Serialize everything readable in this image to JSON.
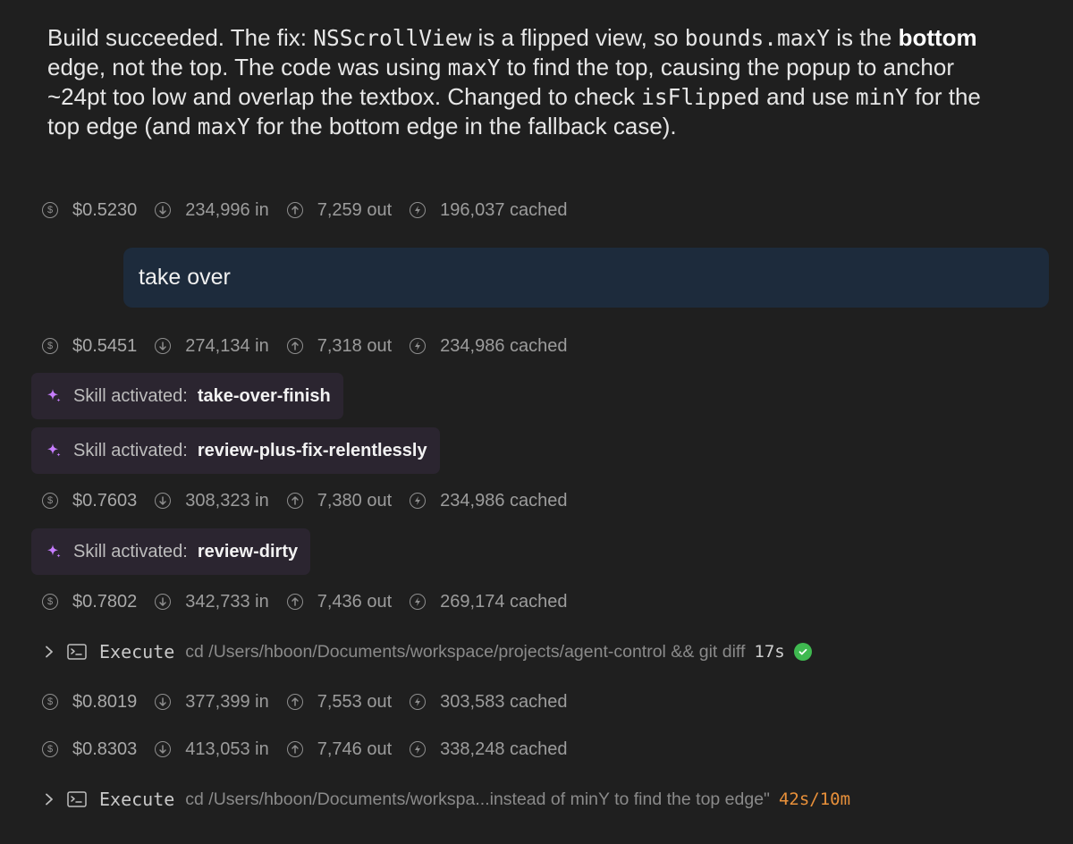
{
  "message": {
    "p1": "Build succeeded. The fix: ",
    "c1": "NSScrollView",
    "p2": " is a flipped view, so ",
    "c2": "bounds.maxY",
    "p3": " is the ",
    "b1": "bottom",
    "p4": " edge, not the top. The code was using ",
    "c3": "maxY",
    "p5": " to find the top, causing the popup to anchor ~24pt too low and overlap the textbox. Changed to check ",
    "c4": "isFlipped",
    "p6": " and use ",
    "c5": "minY",
    "p7": " for the top edge (and ",
    "c6": "maxY",
    "p8": " for the bottom edge in the fallback case)."
  },
  "stats": [
    {
      "cost": "$0.5230",
      "in": "234,996 in",
      "out": "7,259 out",
      "cached": "196,037 cached"
    },
    {
      "cost": "$0.5451",
      "in": "274,134 in",
      "out": "7,318 out",
      "cached": "234,986 cached"
    },
    {
      "cost": "$0.7603",
      "in": "308,323 in",
      "out": "7,380 out",
      "cached": "234,986 cached"
    },
    {
      "cost": "$0.7802",
      "in": "342,733 in",
      "out": "7,436 out",
      "cached": "269,174 cached"
    },
    {
      "cost": "$0.8019",
      "in": "377,399 in",
      "out": "7,553 out",
      "cached": "303,583 cached"
    },
    {
      "cost": "$0.8303",
      "in": "413,053 in",
      "out": "7,746 out",
      "cached": "338,248 cached"
    }
  ],
  "user_message": "take over",
  "skills": {
    "prefix": "Skill activated:",
    "items": [
      "take-over-finish",
      "review-plus-fix-relentlessly",
      "review-dirty"
    ]
  },
  "executes": [
    {
      "label": "Execute",
      "command": "cd /Users/hboon/Documents/workspace/projects/agent-control && git diff",
      "time": "17s",
      "status": "success"
    },
    {
      "label": "Execute",
      "command": "cd /Users/hboon/Documents/workspa...instead of minY to find the top edge\"",
      "time": "42s/10m",
      "status": "running"
    }
  ],
  "colors": {
    "background": "#1f1f1f",
    "user_bubble": "#1d2b3c",
    "skill_chip": "#2b2530",
    "sparkle": "#c77dff",
    "success": "#3fb950",
    "running_time": "#e8903a"
  },
  "icons": [
    "dollar-icon",
    "arrow-down-icon",
    "arrow-up-icon",
    "lightning-icon",
    "sparkle-icon",
    "chevron-right-icon",
    "terminal-icon",
    "check-circle-icon"
  ]
}
